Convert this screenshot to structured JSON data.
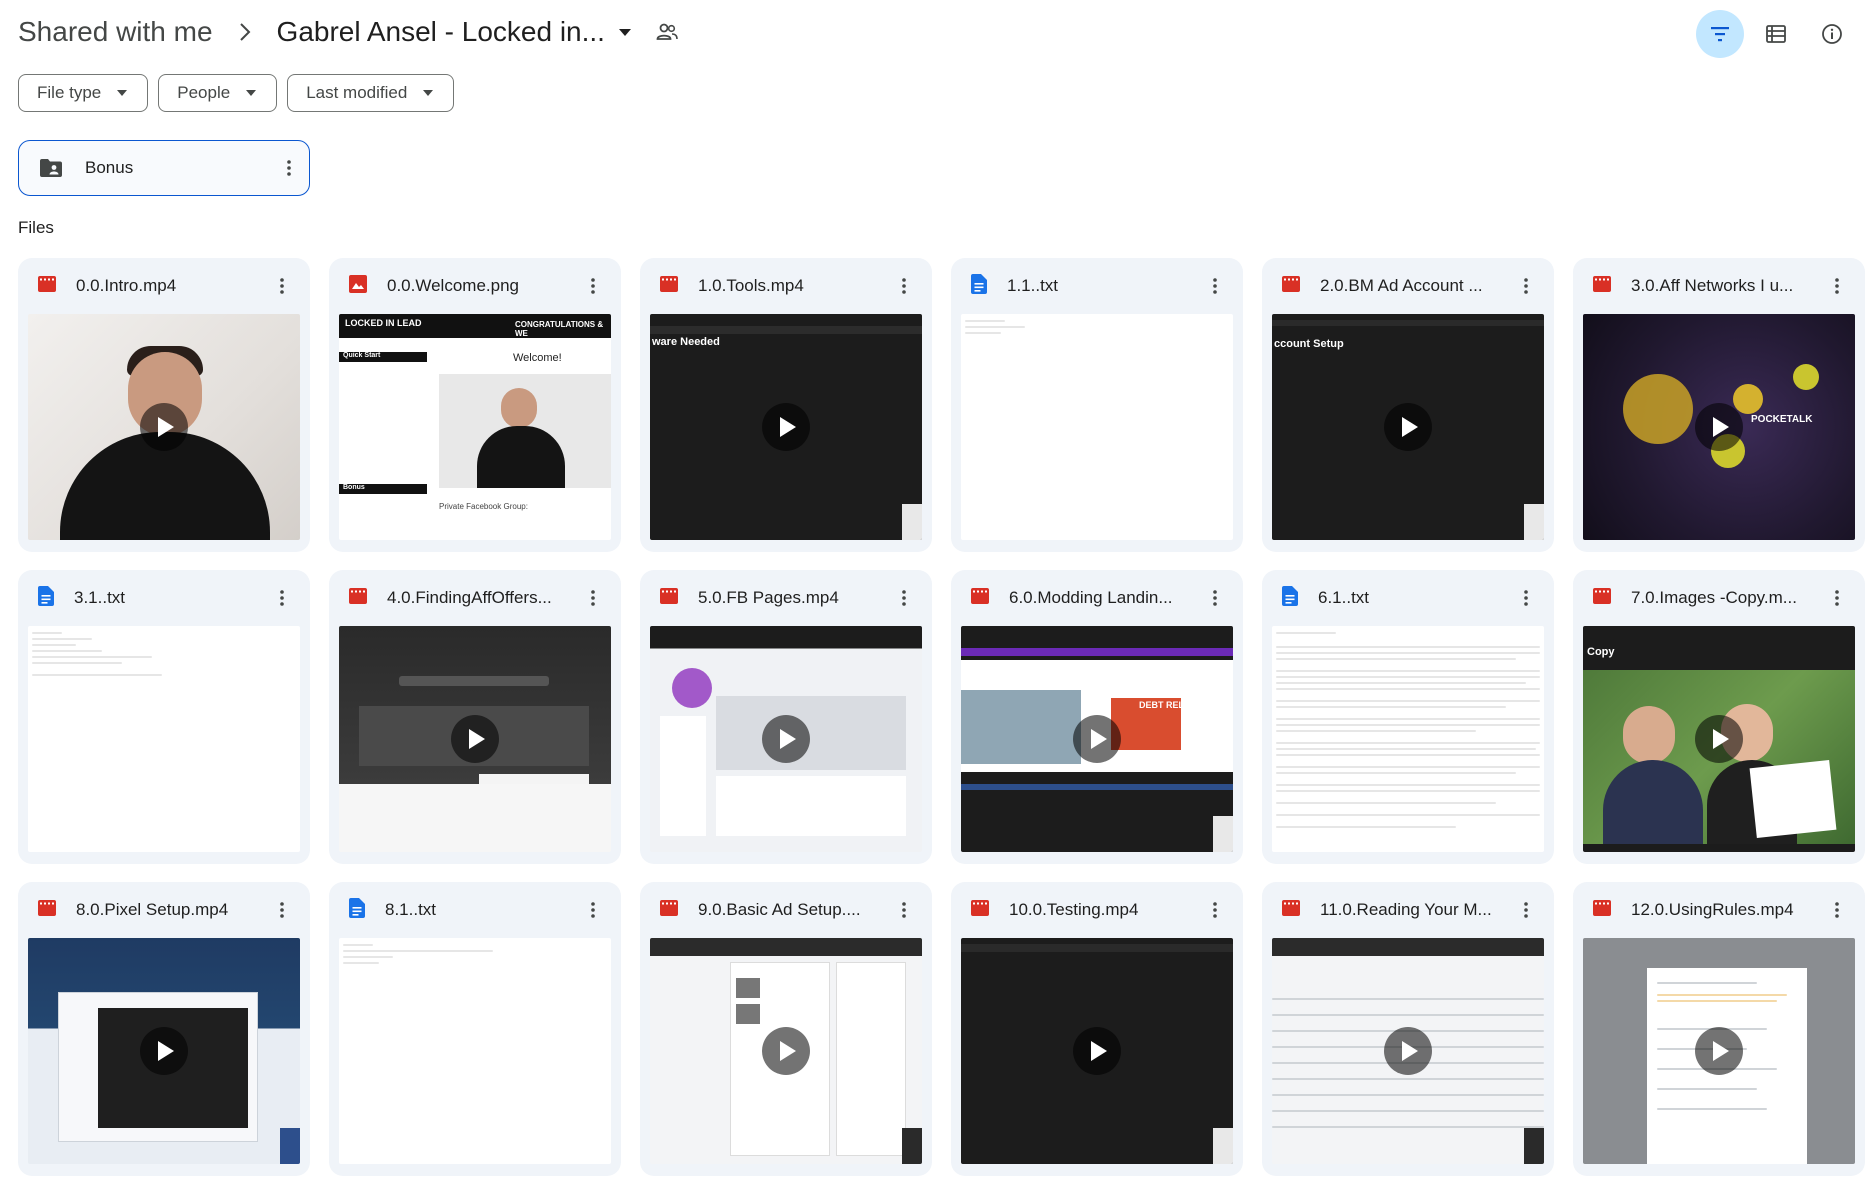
{
  "breadcrumb": {
    "root": "Shared with me",
    "current": "Gabrel Ansel - Locked in..."
  },
  "filters": [
    {
      "label": "File type"
    },
    {
      "label": "People"
    },
    {
      "label": "Last modified"
    }
  ],
  "folder": {
    "name": "Bonus"
  },
  "files_label": "Files",
  "colors": {
    "accent": "#0b57d0",
    "active_btn": "#c2e7ff",
    "card_bg": "#f0f4f9",
    "video_icon": "#d93025",
    "image_icon": "#d93025",
    "doc_icon": "#1a73e8"
  },
  "files": [
    {
      "name": "0.0.Intro.mp4",
      "kind": "video"
    },
    {
      "name": "0.0.Welcome.png",
      "kind": "image"
    },
    {
      "name": "1.0.Tools.mp4",
      "kind": "video",
      "thumb_text": "ware Needed"
    },
    {
      "name": "1.1..txt",
      "kind": "doc"
    },
    {
      "name": "2.0.BM Ad Account ...",
      "kind": "video",
      "thumb_text": "ccount Setup"
    },
    {
      "name": "3.0.Aff Networks I u...",
      "kind": "video",
      "thumb_text": "POCKETALK"
    },
    {
      "name": "3.1..txt",
      "kind": "doc"
    },
    {
      "name": "4.0.FindingAffOffers...",
      "kind": "video"
    },
    {
      "name": "5.0.FB Pages.mp4",
      "kind": "video"
    },
    {
      "name": "6.0.Modding Landin...",
      "kind": "video",
      "thumb_text": "DEBT RELIEF"
    },
    {
      "name": "6.1..txt",
      "kind": "doc"
    },
    {
      "name": "7.0.Images -Copy.m...",
      "kind": "video",
      "thumb_text": "Copy"
    },
    {
      "name": "8.0.Pixel Setup.mp4",
      "kind": "video"
    },
    {
      "name": "8.1..txt",
      "kind": "doc"
    },
    {
      "name": "9.0.Basic Ad Setup....",
      "kind": "video"
    },
    {
      "name": "10.0.Testing.mp4",
      "kind": "video"
    },
    {
      "name": "11.0.Reading Your M...",
      "kind": "video"
    },
    {
      "name": "12.0.UsingRules.mp4",
      "kind": "video"
    }
  ],
  "welcome_thumb": {
    "title": "LOCKED IN LEAD",
    "congrats": "CONGRATULATIONS & WE",
    "heading": "Welcome!",
    "quick_start": "Quick Start",
    "bonus": "Bonus",
    "facebook_group": "Private Facebook Group:"
  },
  "icons": {
    "share": "people-icon",
    "filter": "filter-icon",
    "list_view": "list-view-icon",
    "info": "info-icon",
    "more": "more-vert-icon",
    "folder": "shared-folder-icon"
  }
}
